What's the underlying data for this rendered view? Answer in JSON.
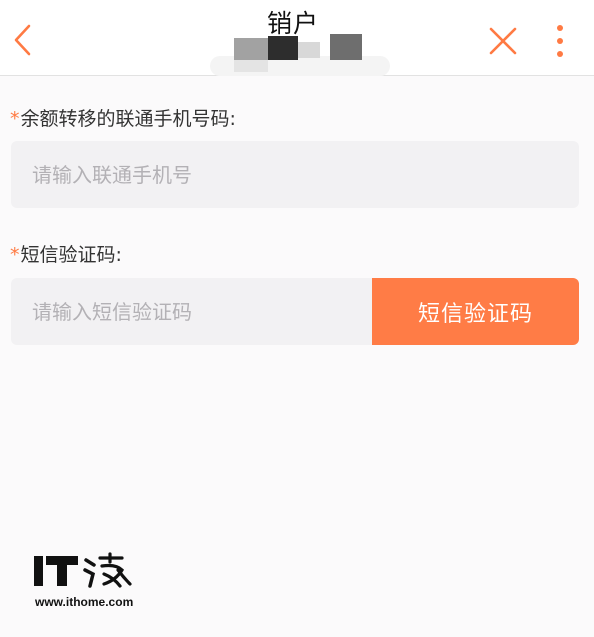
{
  "header": {
    "title": "销户",
    "back_icon": "chevron-left-icon",
    "close_icon": "close-icon",
    "more_icon": "more-vertical-icon"
  },
  "form": {
    "phone": {
      "required_mark": "*",
      "label": "余额转移的联通手机号码:",
      "placeholder": "请输入联通手机号",
      "value": ""
    },
    "sms": {
      "required_mark": "*",
      "label": "短信验证码:",
      "placeholder": "请输入短信验证码",
      "value": "",
      "button_label": "短信验证码"
    }
  },
  "watermark": {
    "logo_text": "IT之家",
    "url": "www.ithome.com"
  },
  "colors": {
    "accent": "#ff7c46",
    "input_bg": "#f2f1f3",
    "page_bg": "#fbfafb",
    "placeholder": "#b3b1b5"
  }
}
